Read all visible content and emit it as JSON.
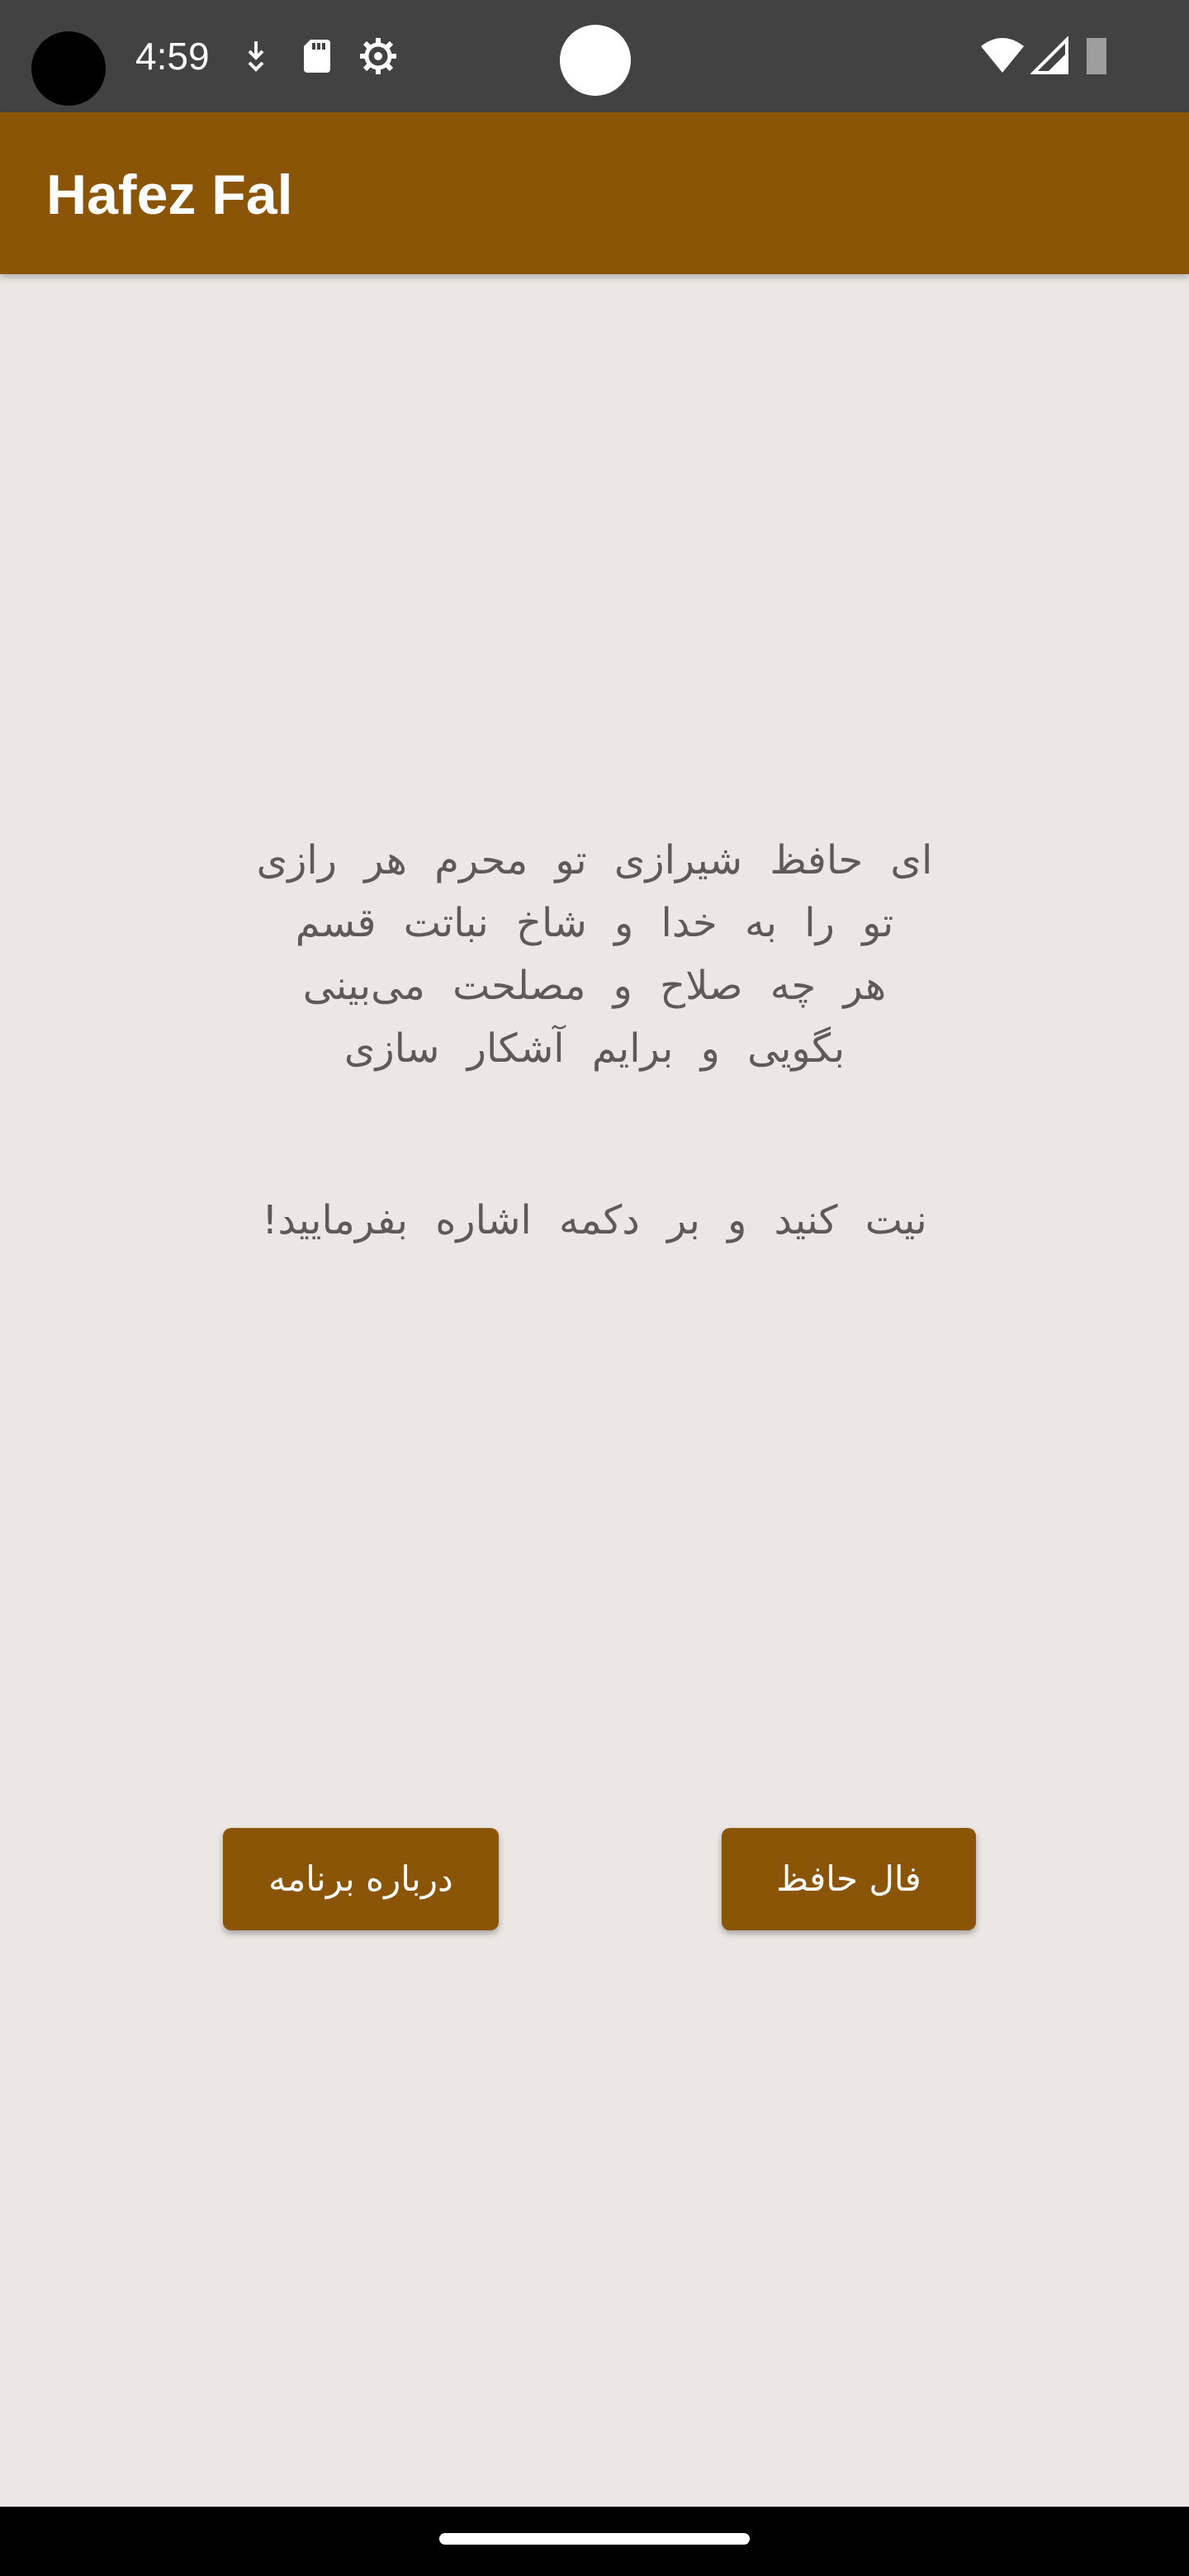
{
  "status_bar": {
    "time": "4:59",
    "icons": [
      "camera-cutout",
      "download-icon",
      "sd-card-icon",
      "settings-gear-icon",
      "wifi-icon",
      "signal-icon",
      "battery-icon"
    ]
  },
  "app_bar": {
    "title": "Hafez Fal",
    "color": "#8b5508"
  },
  "main": {
    "poem_lines": [
      "ای حافظ شیرازی تو محرم هر رازی",
      "تو را به خدا و شاخ نباتت قسم",
      "هر چه صلاح و مصلحت می‌بینی",
      "بگویی و برایم آشکار سازی"
    ],
    "instruction": "نیت کنید و بر دکمه اشاره بفرمایید!"
  },
  "buttons": {
    "about_label": "درباره برنامه",
    "fal_label": "فال حافظ"
  },
  "colors": {
    "background": "#ece7e4",
    "text": "#5e5a57",
    "accent": "#8b5508",
    "status_bar": "#424242"
  }
}
